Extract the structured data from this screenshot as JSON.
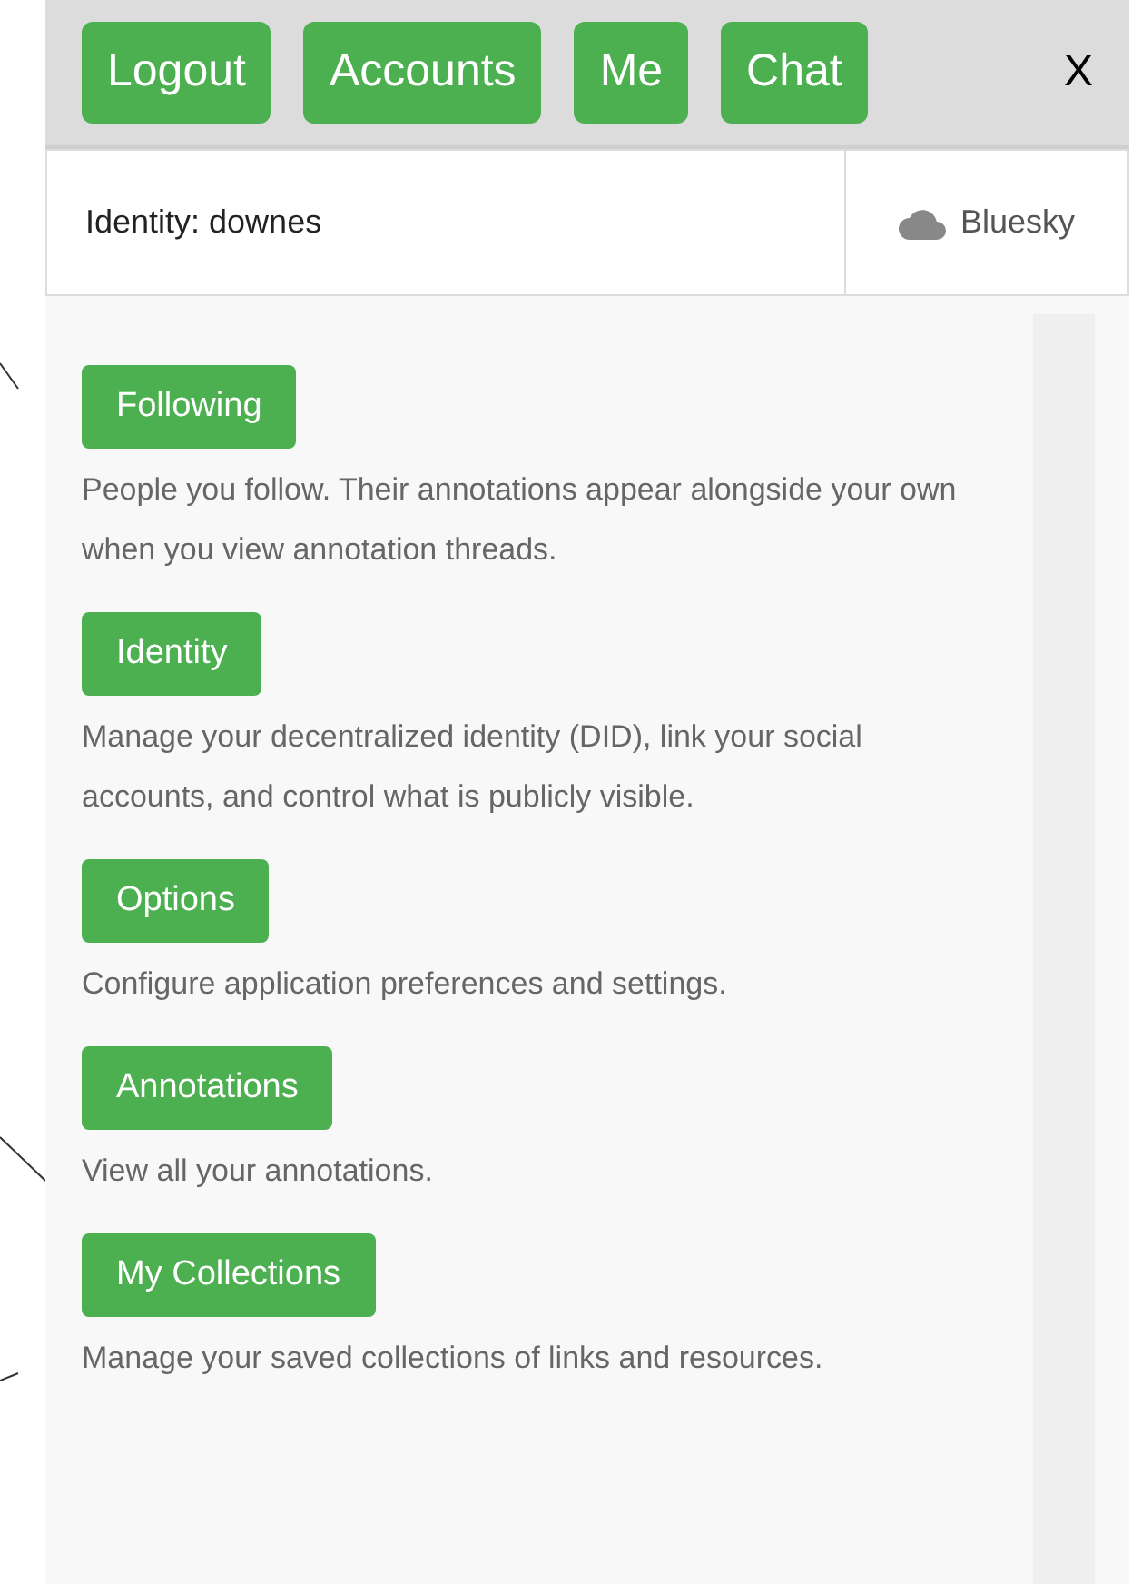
{
  "top_bar": {
    "buttons": [
      "Logout",
      "Accounts",
      "Me",
      "Chat"
    ],
    "close": "X"
  },
  "identity_bar": {
    "label": "Identity: downes",
    "network": "Bluesky"
  },
  "sections": [
    {
      "button": "Following",
      "description": "People you follow. Their annotations appear alongside your own when you view annotation threads."
    },
    {
      "button": "Identity",
      "description": "Manage your decentralized identity (DID), link your social accounts, and control what is publicly visible."
    },
    {
      "button": "Options",
      "description": "Configure application preferences and settings."
    },
    {
      "button": "Annotations",
      "description": "View all your annotations."
    },
    {
      "button": "My Collections",
      "description": "Manage your saved collections of links and resources."
    }
  ]
}
